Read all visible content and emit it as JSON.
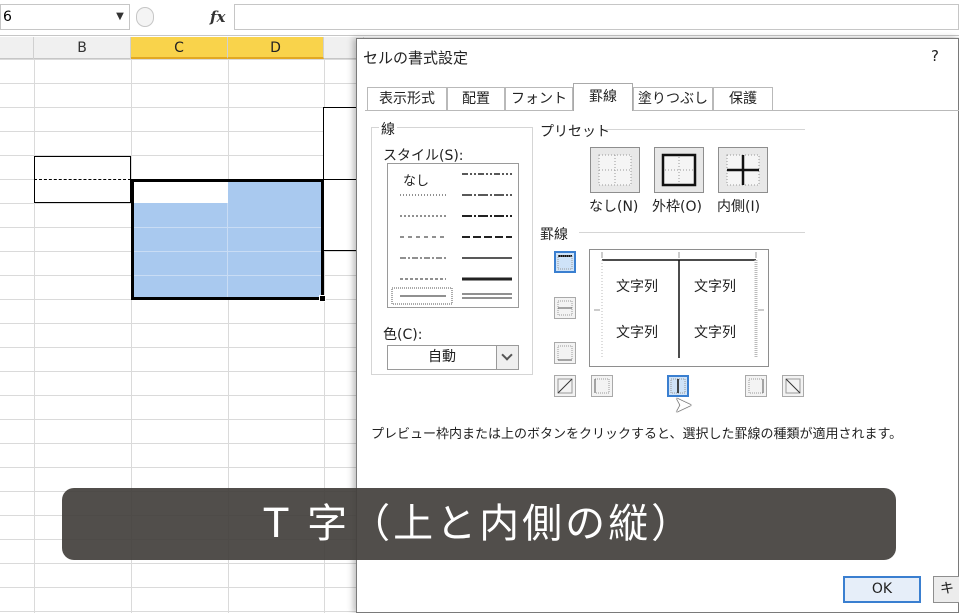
{
  "excel": {
    "name_box": "6",
    "fx_label": "fx",
    "columns": [
      "B",
      "C",
      "D"
    ]
  },
  "dialog": {
    "title": "セルの書式設定",
    "help": "?",
    "tabs": [
      {
        "label": "表示形式"
      },
      {
        "label": "配置"
      },
      {
        "label": "フォント"
      },
      {
        "label": "罫線",
        "active": true
      },
      {
        "label": "塗りつぶし"
      },
      {
        "label": "保護"
      }
    ],
    "line_group": {
      "label": "線",
      "style_label": "スタイル(S):",
      "none_label": "なし",
      "color_label": "色(C):",
      "color_value": "自動"
    },
    "presets": {
      "label": "プリセット",
      "items": [
        "なし(N)",
        "外枠(O)",
        "内側(I)"
      ]
    },
    "border": {
      "label": "罫線",
      "preview_text": [
        "文字列",
        "文字列",
        "文字列",
        "文字列"
      ]
    },
    "description": "プレビュー枠内または上のボタンをクリックすると、選択した罫線の種類が適用されます。",
    "ok_label": "OK",
    "cancel_label": "キ"
  },
  "caption": "T 字（上と内側の縦）",
  "colors": {
    "selection": "#a9c9ef",
    "active_tab_border": "#a9a9a9",
    "button_focus": "#3a7fd0",
    "caption_bg": "#423f3c",
    "column_highlight": "#f9d34b"
  }
}
